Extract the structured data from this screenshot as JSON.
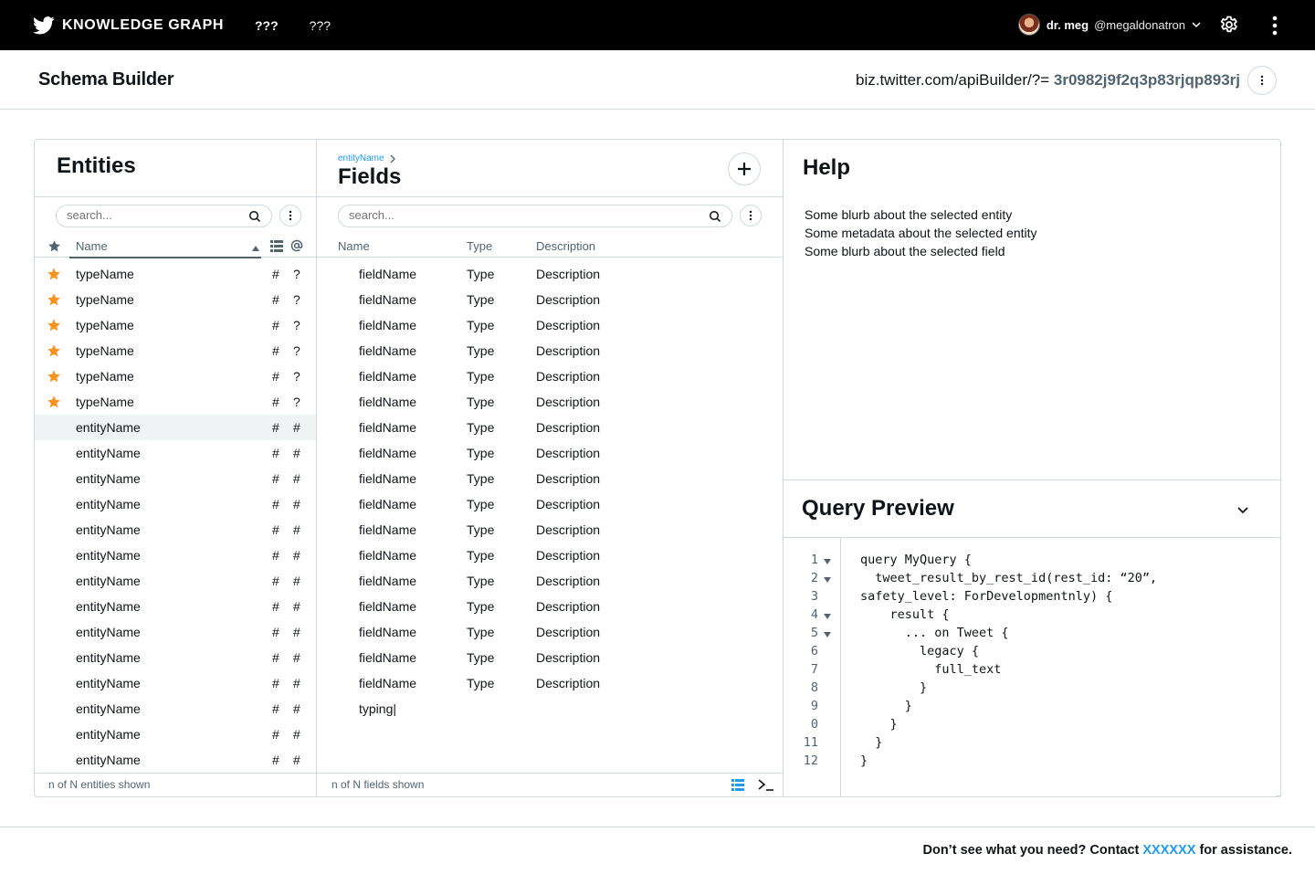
{
  "topbar": {
    "brand": "KNOWLEDGE GRAPH",
    "nav": [
      "???",
      "???"
    ],
    "user_name": "dr. meg",
    "user_handle": "@megaldonatron"
  },
  "header": {
    "title": "Schema Builder",
    "url_prefix": "biz.twitter.com/apiBuilder/?=",
    "url_hash": "3r0982j9f2q3p83rjqp893rj"
  },
  "entities": {
    "title": "Entities",
    "search_placeholder": "search...",
    "column_name": "Name",
    "footer": "n of N entities shown",
    "rows": [
      {
        "name": "typeName",
        "starred": true,
        "c1": "#",
        "c2": "?"
      },
      {
        "name": "typeName",
        "starred": true,
        "c1": "#",
        "c2": "?"
      },
      {
        "name": "typeName",
        "starred": true,
        "c1": "#",
        "c2": "?"
      },
      {
        "name": "typeName",
        "starred": true,
        "c1": "#",
        "c2": "?"
      },
      {
        "name": "typeName",
        "starred": true,
        "c1": "#",
        "c2": "?"
      },
      {
        "name": "typeName",
        "starred": true,
        "c1": "#",
        "c2": "?"
      },
      {
        "name": "entityName",
        "starred": false,
        "selected": true,
        "c1": "#",
        "c2": "#"
      },
      {
        "name": "entityName",
        "starred": false,
        "c1": "#",
        "c2": "#"
      },
      {
        "name": "entityName",
        "starred": false,
        "c1": "#",
        "c2": "#"
      },
      {
        "name": "entityName",
        "starred": false,
        "c1": "#",
        "c2": "#"
      },
      {
        "name": "entityName",
        "starred": false,
        "c1": "#",
        "c2": "#"
      },
      {
        "name": "entityName",
        "starred": false,
        "c1": "#",
        "c2": "#"
      },
      {
        "name": "entityName",
        "starred": false,
        "c1": "#",
        "c2": "#"
      },
      {
        "name": "entityName",
        "starred": false,
        "c1": "#",
        "c2": "#"
      },
      {
        "name": "entityName",
        "starred": false,
        "c1": "#",
        "c2": "#"
      },
      {
        "name": "entityName",
        "starred": false,
        "c1": "#",
        "c2": "#"
      },
      {
        "name": "entityName",
        "starred": false,
        "c1": "#",
        "c2": "#"
      },
      {
        "name": "entityName",
        "starred": false,
        "c1": "#",
        "c2": "#"
      },
      {
        "name": "entityName",
        "starred": false,
        "c1": "#",
        "c2": "#"
      },
      {
        "name": "entityName",
        "starred": false,
        "c1": "#",
        "c2": "#"
      }
    ]
  },
  "fields": {
    "breadcrumb": "entityName",
    "title": "Fields",
    "search_placeholder": "search...",
    "columns": [
      "Name",
      "Type",
      "Description"
    ],
    "footer": "n of N fields shown",
    "rows": [
      {
        "name": "fieldName",
        "type": "Type",
        "description": "Description"
      },
      {
        "name": "fieldName",
        "type": "Type",
        "description": "Description"
      },
      {
        "name": "fieldName",
        "type": "Type",
        "description": "Description"
      },
      {
        "name": "fieldName",
        "type": "Type",
        "description": "Description"
      },
      {
        "name": "fieldName",
        "type": "Type",
        "description": "Description"
      },
      {
        "name": "fieldName",
        "type": "Type",
        "description": "Description"
      },
      {
        "name": "fieldName",
        "type": "Type",
        "description": "Description"
      },
      {
        "name": "fieldName",
        "type": "Type",
        "description": "Description"
      },
      {
        "name": "fieldName",
        "type": "Type",
        "description": "Description"
      },
      {
        "name": "fieldName",
        "type": "Type",
        "description": "Description"
      },
      {
        "name": "fieldName",
        "type": "Type",
        "description": "Description"
      },
      {
        "name": "fieldName",
        "type": "Type",
        "description": "Description"
      },
      {
        "name": "fieldName",
        "type": "Type",
        "description": "Description"
      },
      {
        "name": "fieldName",
        "type": "Type",
        "description": "Description"
      },
      {
        "name": "fieldName",
        "type": "Type",
        "description": "Description"
      },
      {
        "name": "fieldName",
        "type": "Type",
        "description": "Description"
      },
      {
        "name": "fieldName",
        "type": "Type",
        "description": "Description"
      }
    ],
    "typing_value": "typing|"
  },
  "help": {
    "title": "Help",
    "lines": [
      "Some blurb about the selected entity",
      "Some metadata about the selected entity",
      "Some blurb about the selected field"
    ]
  },
  "query_preview": {
    "title": "Query Preview",
    "lines": [
      {
        "n": "1",
        "fold": true,
        "text": "query MyQuery {"
      },
      {
        "n": "2",
        "fold": true,
        "text": "  tweet_result_by_rest_id(rest_id: “20”,"
      },
      {
        "n": "3",
        "fold": false,
        "text": "safety_level: ForDevelopmentnly) {"
      },
      {
        "n": "4",
        "fold": true,
        "text": "    result {"
      },
      {
        "n": "5",
        "fold": true,
        "text": "      ... on Tweet {"
      },
      {
        "n": "6",
        "fold": false,
        "text": "        legacy {"
      },
      {
        "n": "7",
        "fold": false,
        "text": "          full_text"
      },
      {
        "n": "8",
        "fold": false,
        "text": "        }"
      },
      {
        "n": "9",
        "fold": false,
        "text": "      }"
      },
      {
        "n": "0",
        "fold": false,
        "text": "    }"
      },
      {
        "n": "11",
        "fold": false,
        "text": "  }"
      },
      {
        "n": "12",
        "fold": false,
        "text": "}"
      }
    ]
  },
  "footer": {
    "prefix": "Don’t see what you need? Contact ",
    "contact": "XXXXXX",
    "suffix": " for assistance."
  },
  "colors": {
    "accent": "#1d9bf0",
    "star": "#f7931e",
    "border": "#cfd9de",
    "muted": "#536471"
  }
}
